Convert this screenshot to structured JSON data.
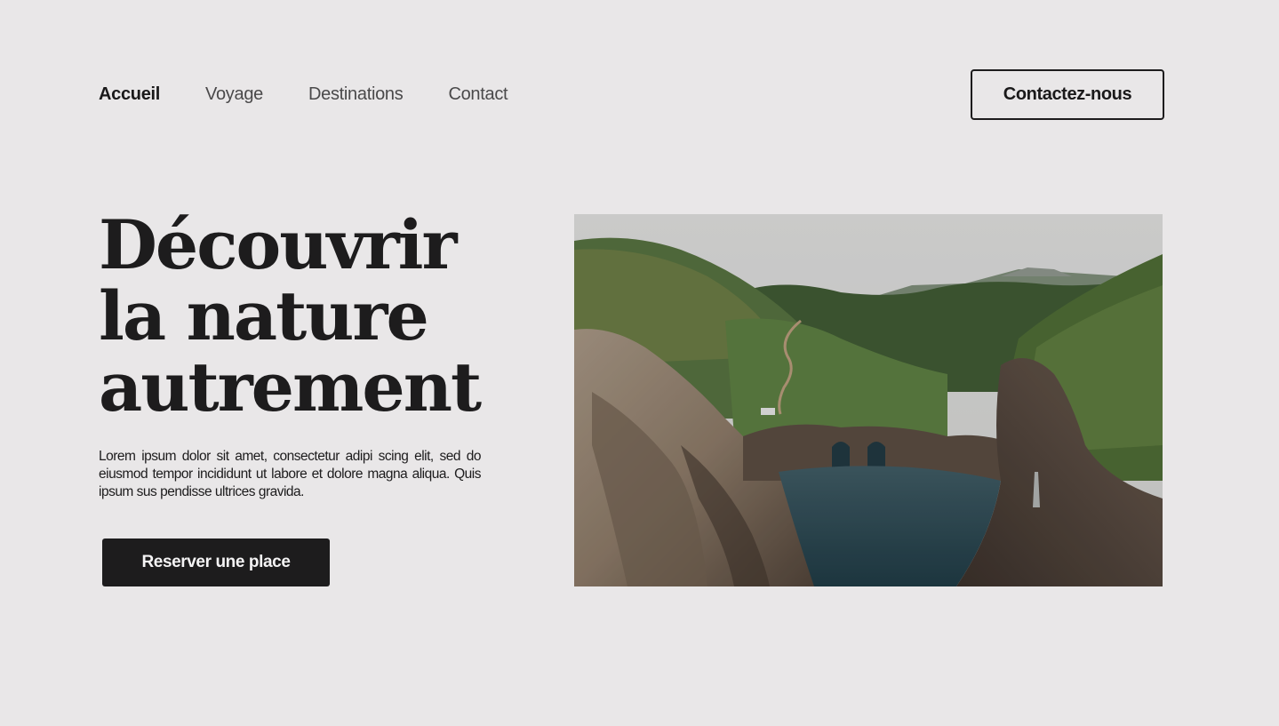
{
  "nav": {
    "items": [
      {
        "label": "Accueil",
        "active": true
      },
      {
        "label": "Voyage",
        "active": false
      },
      {
        "label": "Destinations",
        "active": false
      },
      {
        "label": "Contact",
        "active": false
      }
    ],
    "cta_label": "Contactez-nous"
  },
  "hero": {
    "title_lines": [
      "Découvrir",
      "la nature",
      "autrement"
    ],
    "paragraph": "Lorem ipsum dolor sit amet, consectetur adipi scing elit, sed do eiusmod tempor incididunt ut labore et dolore magna aliqua. Quis ipsum sus pendisse ultrices gravida.",
    "button_label": "Reserver une place",
    "image": {
      "subject": "coastal cliffs with sea inlet, green hills and trail"
    }
  },
  "colors": {
    "background": "#e9e7e8",
    "text_dark": "#1d1c1d",
    "nav_inactive": "#4a494a",
    "button_bg": "#1d1c1d",
    "button_text": "#f4f3f4"
  }
}
